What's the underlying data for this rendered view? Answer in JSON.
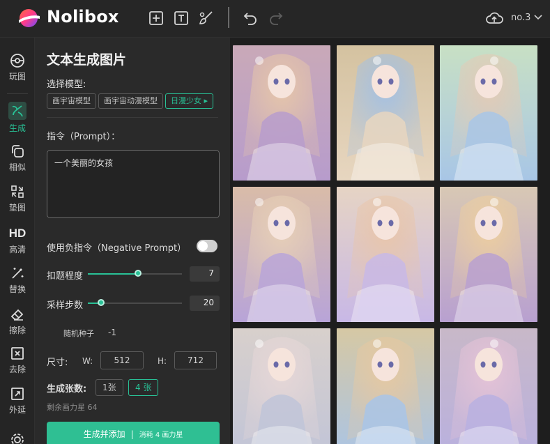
{
  "app": {
    "brand": "Nolibox",
    "account": "no.3"
  },
  "nav": {
    "items": [
      {
        "label": "玩图",
        "icon": "pokeball-icon"
      },
      {
        "label": "生成",
        "icon": "brush-icon",
        "active": true
      },
      {
        "label": "相似",
        "icon": "copy-icon"
      },
      {
        "label": "垫图",
        "icon": "swap-icon"
      },
      {
        "label": "HD",
        "sub": "高清",
        "icon": "hd-icon"
      },
      {
        "label": "替换",
        "icon": "magic-wand-icon"
      },
      {
        "label": "擦除",
        "icon": "eraser-icon"
      },
      {
        "label": "去除",
        "icon": "remove-box-icon"
      },
      {
        "label": "外延",
        "icon": "expand-icon"
      }
    ]
  },
  "panel": {
    "title": "文本生成图片",
    "model_label": "选择模型:",
    "models": [
      "画宇宙模型",
      "画宇宙动漫模型",
      "日漫少女 ▸"
    ],
    "prompt_label": "指令（Prompt）：",
    "prompt_value": "一个美丽的女孩",
    "negative_label": "使用负指令（Negative Prompt）",
    "negative_enabled": false,
    "fidelity_label": "扣题程度",
    "fidelity_value": "7",
    "steps_label": "采样步数",
    "steps_value": "20",
    "seed_label": "随机种子",
    "seed_value": "-1",
    "size_label": "尺寸:",
    "width_label": "W:",
    "width_value": "512",
    "height_label": "H:",
    "height_value": "712",
    "count_label": "生成张数:",
    "count_options": [
      "1张",
      "4 张"
    ],
    "remaining": "剩余画力星 64",
    "generate_label": "生成并添加",
    "generate_cost": "消耗 4 画力星"
  },
  "colors": {
    "accent": "#29c196",
    "panel_bg": "#2a2a2a",
    "bg": "#1f1f1f"
  }
}
